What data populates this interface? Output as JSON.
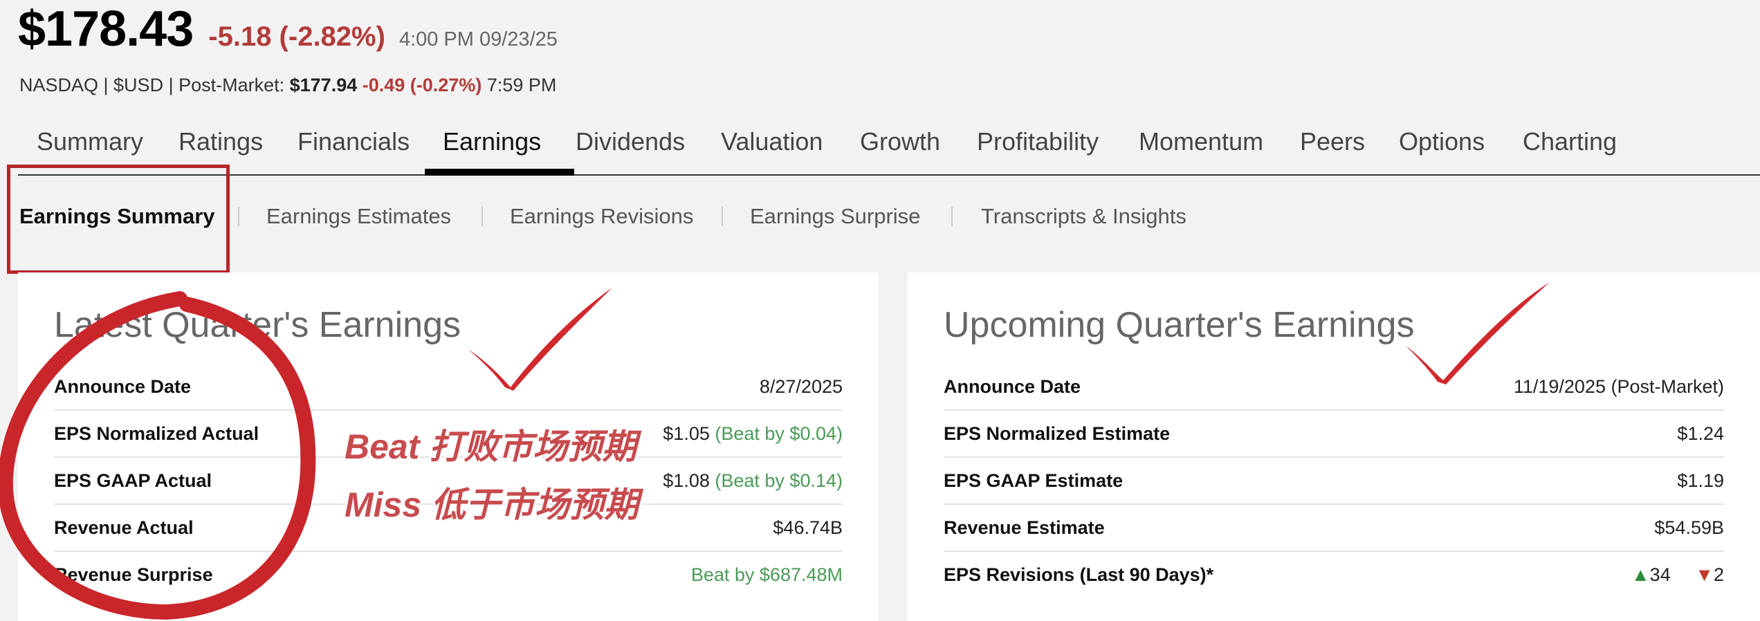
{
  "quote": {
    "price": "$178.43",
    "change": "-5.18 (-2.82%)",
    "timestamp": "4:00 PM 09/23/25"
  },
  "market": {
    "prefix": "NASDAQ | $USD | Post-Market: ",
    "post_price": "$177.94",
    "post_change": "-0.49 (-0.27%)",
    "post_time": "7:59 PM"
  },
  "main_tabs": [
    "Summary",
    "Ratings",
    "Financials",
    "Earnings",
    "Dividends",
    "Valuation",
    "Growth",
    "Profitability",
    "Momentum",
    "Peers",
    "Options",
    "Charting"
  ],
  "active_main_tab": "Earnings",
  "sub_tabs": [
    "Earnings Summary",
    "Earnings Estimates",
    "Earnings Revisions",
    "Earnings Surprise",
    "Transcripts & Insights"
  ],
  "active_sub_tab": "Earnings Summary",
  "latest": {
    "title": "Latest Quarter's Earnings",
    "rows": [
      {
        "label": "Announce Date",
        "value": "8/27/2025",
        "note": ""
      },
      {
        "label": "EPS Normalized Actual",
        "value": "$1.05",
        "note": "(Beat by $0.04)"
      },
      {
        "label": "EPS GAAP Actual",
        "value": "$1.08",
        "note": "(Beat by $0.14)"
      },
      {
        "label": "Revenue Actual",
        "value": "$46.74B",
        "note": ""
      },
      {
        "label": "Revenue Surprise",
        "value": "Beat by $687.48M",
        "note": ""
      }
    ]
  },
  "upcoming": {
    "title": "Upcoming Quarter's Earnings",
    "rows": [
      {
        "label": "Announce Date",
        "value": "11/19/2025 (Post-Market)"
      },
      {
        "label": "EPS Normalized Estimate",
        "value": "$1.24"
      },
      {
        "label": "EPS GAAP Estimate",
        "value": "$1.19"
      },
      {
        "label": "Revenue Estimate",
        "value": "$54.59B"
      },
      {
        "label": "EPS Revisions (Last 90 Days)*",
        "up": "34",
        "down": "2"
      }
    ]
  },
  "annotations": {
    "beat": "Beat 打败市场预期",
    "miss": "Miss 低于市场预期"
  },
  "colors": {
    "negative": "#b33a3a",
    "positive": "#4a9a58",
    "highlight": "#b3262a"
  }
}
